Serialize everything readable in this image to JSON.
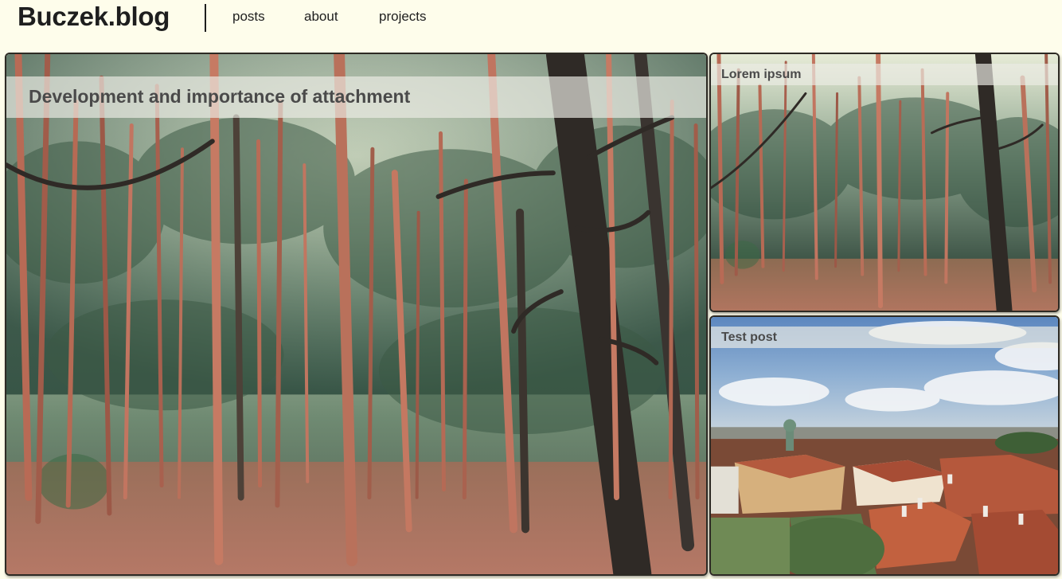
{
  "header": {
    "site_title": "Buczek.blog",
    "nav": [
      {
        "label": "posts"
      },
      {
        "label": "about"
      },
      {
        "label": "projects"
      }
    ]
  },
  "posts": [
    {
      "title": "Development and importance of attachment",
      "image": "pine-forest-photo"
    },
    {
      "title": "Lorem ipsum",
      "image": "pine-forest-photo"
    },
    {
      "title": "Test post",
      "image": "city-rooftops-photo"
    }
  ],
  "colors": {
    "background": "#fefdeb",
    "text": "#1e1e1e",
    "card_border": "#2d2a24"
  }
}
